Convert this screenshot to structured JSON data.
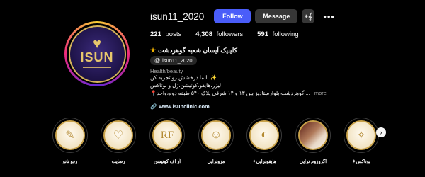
{
  "profile": {
    "username": "isun11_2020",
    "follow_label": "Follow",
    "message_label": "Message",
    "suggest_glyph": "+𝄟",
    "more_glyph": "•••",
    "avatar_brand": "ISUN"
  },
  "stats": {
    "posts_count": "221",
    "posts_label": "posts",
    "followers_count": "4,308",
    "followers_label": "followers",
    "following_count": "591",
    "following_label": "following"
  },
  "bio": {
    "name": "کلینیک آیسان شعبه گوهردشت",
    "threads_handle": "isun11_2020",
    "category": "Health/beauty",
    "lines": [
      "با ما درخشش رو تجربه کن ✨",
      "لیزر،هایفو،کوتیشن،ژل و بوتاکس",
      "📍گوهردشت،بلوارستادیز بین ۱۳ و ۱۴ شرقی پلاک ۵۴۰ طبقه دوم،واحد ..."
    ],
    "more_label": "more",
    "website": "www.isunclinic.com"
  },
  "highlights": [
    {
      "label": "رفع تاتو",
      "kind": "icon"
    },
    {
      "label": "رضایت",
      "kind": "icon"
    },
    {
      "label": "آر اف کوتیشن",
      "kind": "icon"
    },
    {
      "label": "مزوتراپی",
      "kind": "icon"
    },
    {
      "label": "✦هایفوتراپی",
      "kind": "icon"
    },
    {
      "label": "اگزوزوم تراپی",
      "kind": "photo"
    },
    {
      "label": "✦بوتاکس",
      "kind": "icon"
    }
  ],
  "highlights_next_glyph": "›",
  "colors": {
    "follow_button": "#4a5df9",
    "secondary_button": "#363636",
    "background": "#000000",
    "gold": "#c9a24a"
  }
}
